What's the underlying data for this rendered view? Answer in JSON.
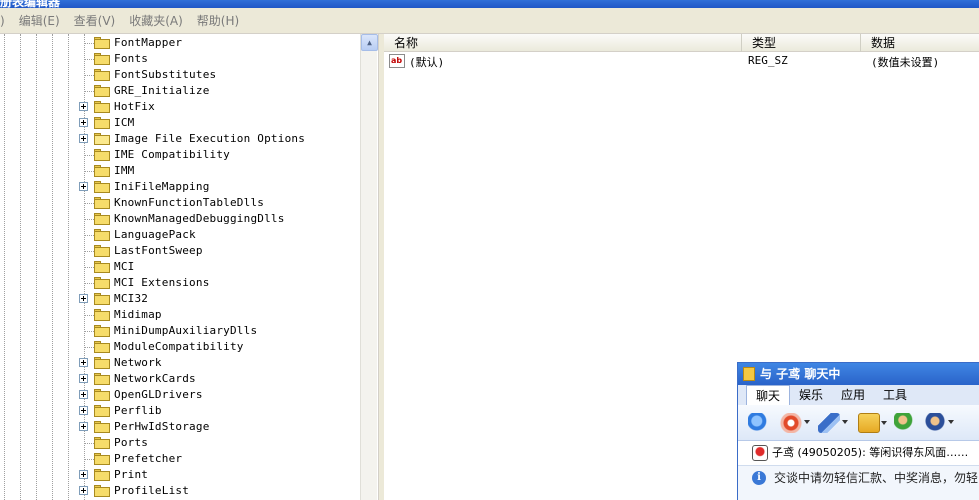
{
  "window": {
    "title": "册表编辑器"
  },
  "menu": [
    "编辑(E)",
    "查看(V)",
    "收藏夹(A)",
    "帮助(H)"
  ],
  "menu_leading": ")",
  "tree": {
    "items": [
      {
        "label": "FontMapper",
        "expandable": false
      },
      {
        "label": "Fonts",
        "expandable": false
      },
      {
        "label": "FontSubstitutes",
        "expandable": false
      },
      {
        "label": "GRE_Initialize",
        "expandable": false
      },
      {
        "label": "HotFix",
        "expandable": true
      },
      {
        "label": "ICM",
        "expandable": true
      },
      {
        "label": "Image File Execution Options",
        "expandable": true,
        "open": true
      },
      {
        "label": "IME Compatibility",
        "expandable": false
      },
      {
        "label": "IMM",
        "expandable": false
      },
      {
        "label": "IniFileMapping",
        "expandable": true
      },
      {
        "label": "KnownFunctionTableDlls",
        "expandable": false
      },
      {
        "label": "KnownManagedDebuggingDlls",
        "expandable": false
      },
      {
        "label": "LanguagePack",
        "expandable": false
      },
      {
        "label": "LastFontSweep",
        "expandable": false
      },
      {
        "label": "MCI",
        "expandable": false
      },
      {
        "label": "MCI Extensions",
        "expandable": false
      },
      {
        "label": "MCI32",
        "expandable": true
      },
      {
        "label": "Midimap",
        "expandable": false
      },
      {
        "label": "MiniDumpAuxiliaryDlls",
        "expandable": false
      },
      {
        "label": "ModuleCompatibility",
        "expandable": false
      },
      {
        "label": "Network",
        "expandable": true
      },
      {
        "label": "NetworkCards",
        "expandable": true
      },
      {
        "label": "OpenGLDrivers",
        "expandable": true
      },
      {
        "label": "Perflib",
        "expandable": true
      },
      {
        "label": "PerHwIdStorage",
        "expandable": true
      },
      {
        "label": "Ports",
        "expandable": false
      },
      {
        "label": "Prefetcher",
        "expandable": false
      },
      {
        "label": "Print",
        "expandable": true
      },
      {
        "label": "ProfileList",
        "expandable": true
      }
    ]
  },
  "list": {
    "columns": [
      "名称",
      "类型",
      "数据"
    ],
    "rows": [
      {
        "name": "(默认)",
        "type": "REG_SZ",
        "data": "(数值未设置)",
        "icon": "string-value-icon"
      }
    ]
  },
  "chat": {
    "title": "与 子鸢 聊天中",
    "tabs": [
      "聊天",
      "娱乐",
      "应用",
      "工具"
    ],
    "active_tab": 0,
    "tools": [
      "contacts-icon",
      "webcam-icon",
      "pen-icon",
      "folder-send-icon",
      "add-friend-icon",
      "customer-service-icon"
    ],
    "message": "子鸢 (49050205): 等闲识得东风面……",
    "notice": "交谈中请勿轻信汇款、中奖消息，勿轻"
  }
}
